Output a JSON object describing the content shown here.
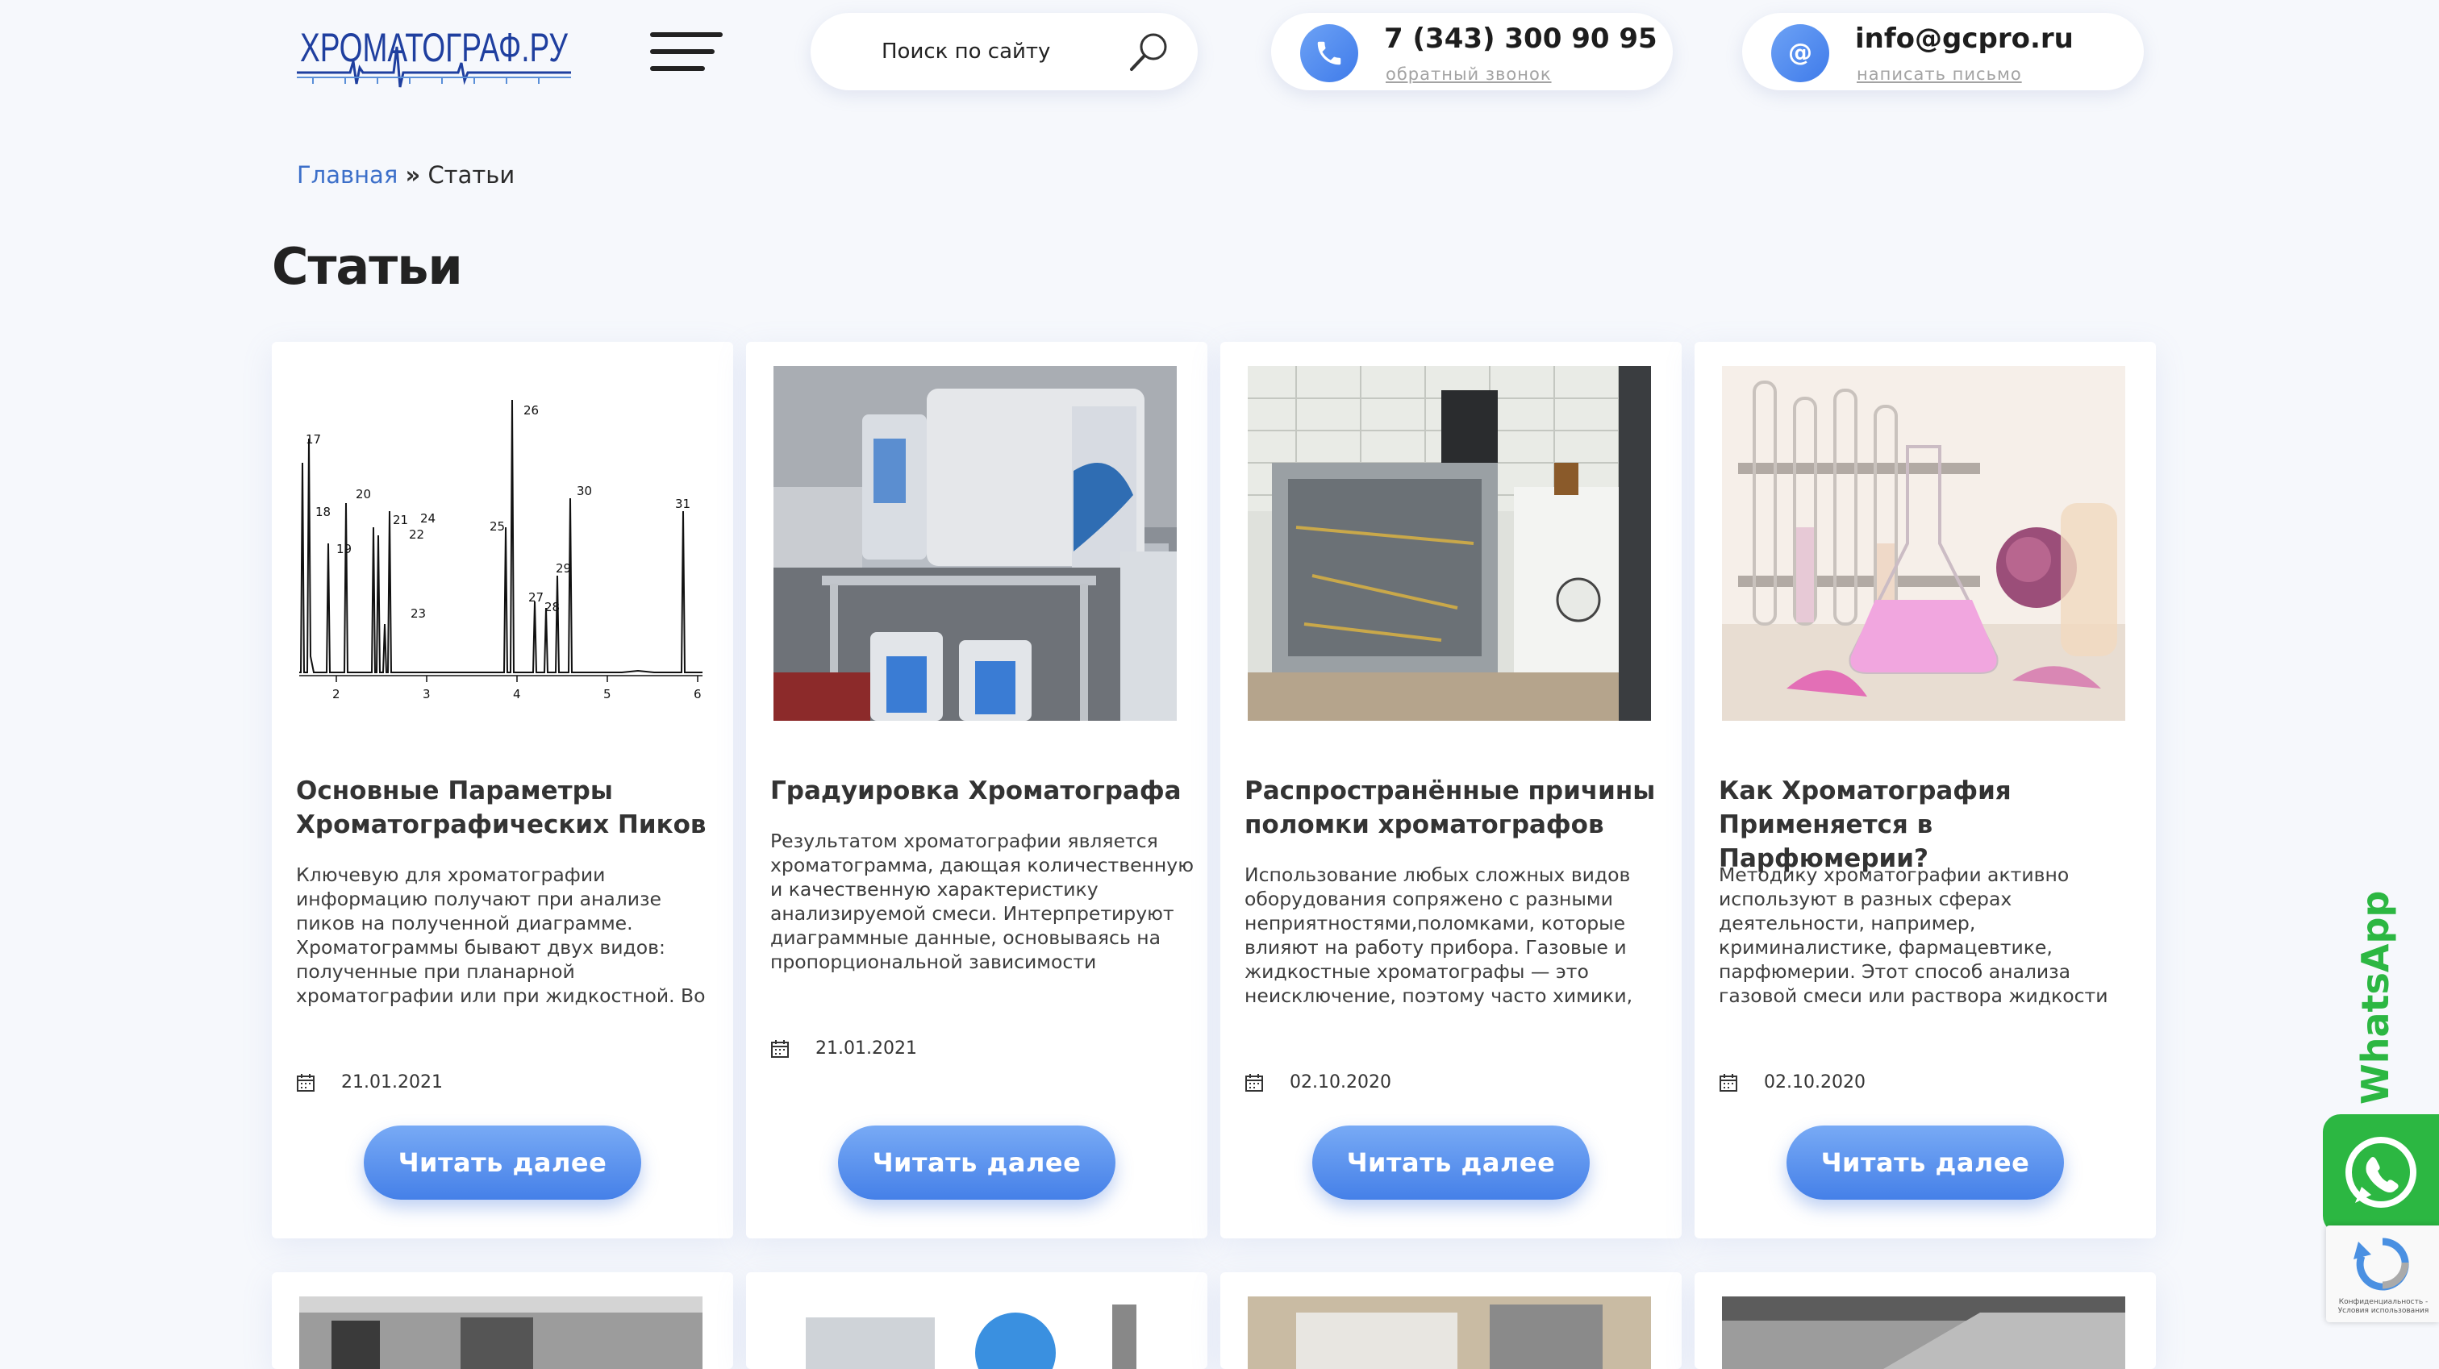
{
  "header": {
    "logo_alt": "ХРОМАТОГРАФ.РУ",
    "search": {
      "label": "Поиск по сайту"
    },
    "phone": {
      "number": "7 (343) 300 90 95",
      "action": "обратный звонок"
    },
    "email": {
      "address": "info@gcpro.ru",
      "action": "написать письмо"
    }
  },
  "breadcrumb": {
    "home": "Главная",
    "separator": "»",
    "current": "Статьи"
  },
  "page_title": "Статьи",
  "articles": [
    {
      "title": "Основные Параметры Хроматографических Пиков",
      "excerpt": "Ключевую для хроматографии информацию получают при анализе пиков на полученной диаграмме. Хроматограммы бывают двух видов: полученные при планарной хроматографии или при жидкостной. Во втором случае, как правило, анализ проводится специальным",
      "date": "21.01.2021",
      "button": "Читать далее",
      "image": "chromatogram-chart"
    },
    {
      "title": "Градуировка Хроматографа",
      "excerpt": "Результатом хроматографии является хроматограмма, дающая количественную и качественную характеристику анализируемой смеси. Интерпретируют диаграммные данные, основываясь на пропорциональной зависимости параметров пиков от количеств исходных",
      "date": "21.01.2021",
      "button": "Читать далее",
      "image": "chromatograph-lab-photo"
    },
    {
      "title": "Распространённые причины поломки хроматографов",
      "excerpt": "Использование любых сложных видов оборудования сопряжено с разными неприятностями,поломками, которые влияют на работу прибора. Газовые и жидкостные хроматографы — это неисключение, поэтому часто химики, лаборанты сталкиваются с потребностью",
      "date": "02.10.2020",
      "button": "Читать далее",
      "image": "opened-instrument-photo"
    },
    {
      "title": "Как Хроматография Применяется в Парфюмерии?",
      "excerpt": "Методику хроматографии активно используют в разных сферах деятельности, например, криминалистике, фармацевтике, парфюмерии. Этот способ анализа газовой смеси или раствора жидкости появился достаточно давно, но в течение этого времени он не потерял собственной",
      "date": "02.10.2020",
      "button": "Читать далее",
      "image": "perfume-flasks-photo"
    }
  ],
  "chromatogram": {
    "peak_labels": [
      "17",
      "18",
      "19",
      "20",
      "21",
      "22",
      "23",
      "24",
      "25",
      "26",
      "27",
      "28",
      "29",
      "30",
      "31"
    ],
    "x_ticks": [
      "2",
      "3",
      "4",
      "5",
      "6"
    ]
  },
  "widgets": {
    "whatsapp": "WhatsApp",
    "recaptcha": "Конфиденциальность - Условия использования"
  },
  "colors": {
    "accent": "#4580e8",
    "link": "#3c6fc9",
    "whatsapp": "#2cb742"
  }
}
